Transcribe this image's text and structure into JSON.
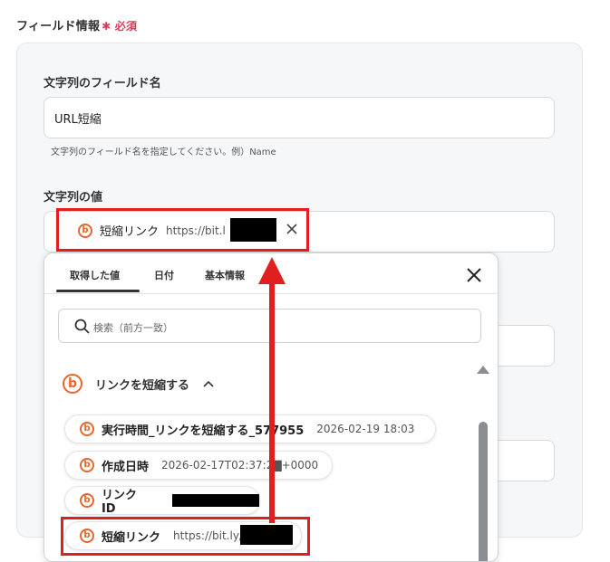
{
  "section": {
    "title": "フィールド情報",
    "required_mark": "✱",
    "required_label": "必須"
  },
  "field_name": {
    "label": "文字列のフィールド名",
    "value": "URL短縮",
    "hint": "文字列のフィールド名を指定してください。例）Name"
  },
  "field_value": {
    "label": "文字列の値",
    "chip": {
      "name": "短縮リンク",
      "value": "https://bit.l",
      "remove_icon": "close-icon"
    }
  },
  "popup": {
    "tabs": [
      {
        "label": "取得した値",
        "active": true
      },
      {
        "label": "日付",
        "active": false
      },
      {
        "label": "基本情報",
        "active": false
      }
    ],
    "search": {
      "placeholder": "検索（前方一致）",
      "icon": "search-icon"
    },
    "group": {
      "label": "リンクを短縮する",
      "icon": "bitly-icon",
      "expanded": true
    },
    "items": [
      {
        "name": "実行時間_リンクを短縮する_577955",
        "value": "2026-02-19 18:03"
      },
      {
        "name": "作成日時",
        "value": "2026-02-17T02:37:2▇+0000"
      },
      {
        "name": "リンクID",
        "value": ""
      },
      {
        "name": "短縮リンク",
        "value": "https://bit.ly/"
      }
    ]
  },
  "colors": {
    "accent_red": "#e02020",
    "bitly_orange": "#e8662c",
    "required_pink": "#e03a5a"
  }
}
